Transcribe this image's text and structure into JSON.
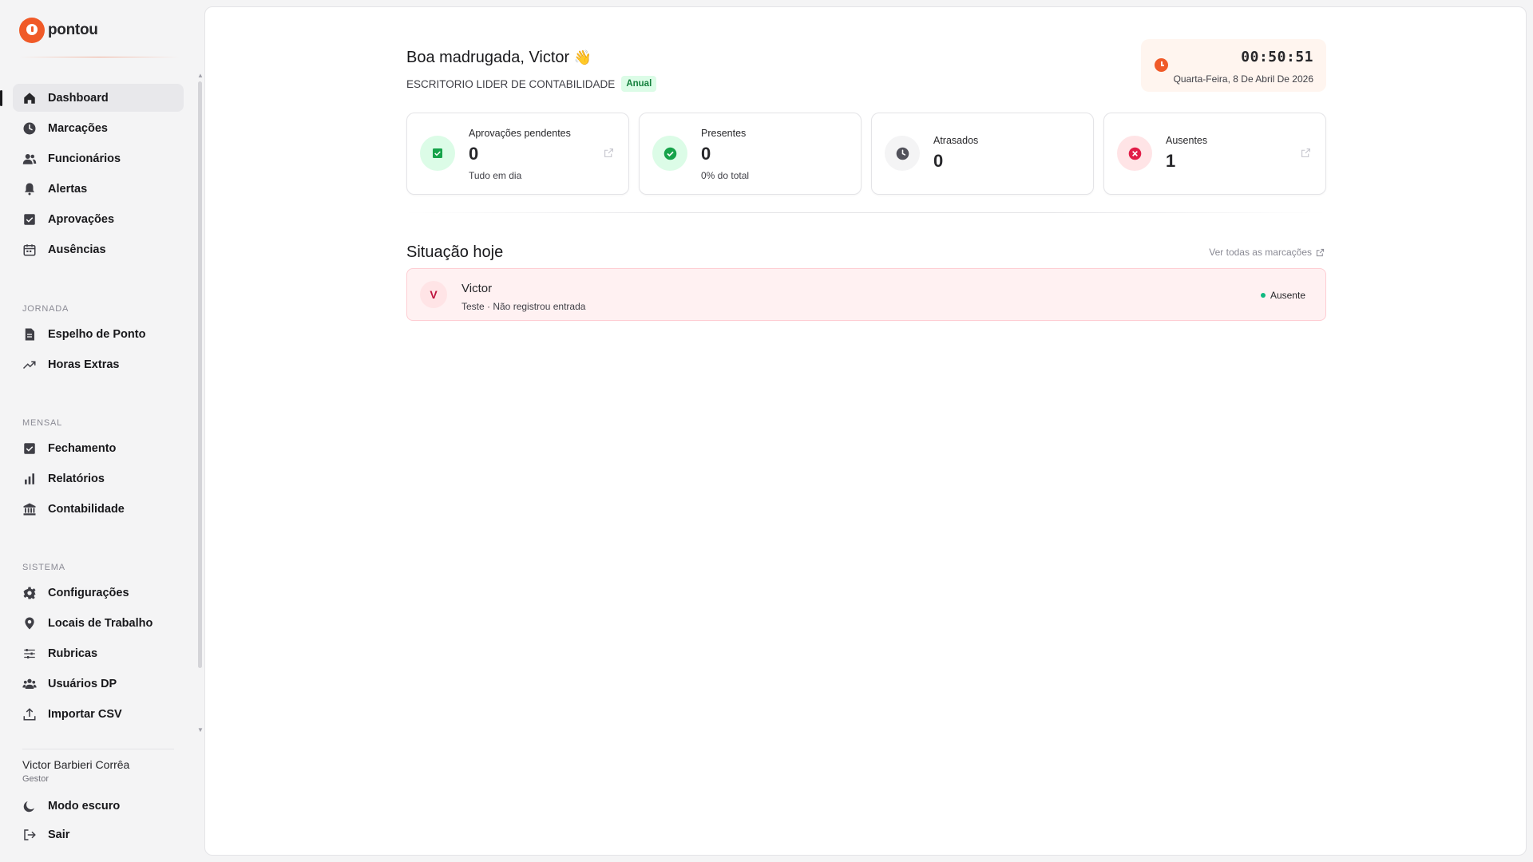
{
  "app": {
    "logo_text": "pontou",
    "brand_color": "#f05a28"
  },
  "sidebar": {
    "main_items": [
      {
        "label": "Dashboard",
        "icon": "home-icon",
        "active": true
      },
      {
        "label": "Marcações",
        "icon": "clock-icon"
      },
      {
        "label": "Funcionários",
        "icon": "users-icon"
      },
      {
        "label": "Alertas",
        "icon": "bell-icon"
      },
      {
        "label": "Aprovações",
        "icon": "check-square-icon"
      },
      {
        "label": "Ausências",
        "icon": "calendar-icon"
      }
    ],
    "sections": [
      {
        "title": "JORNADA",
        "items": [
          {
            "label": "Espelho de Ponto",
            "icon": "document-icon"
          },
          {
            "label": "Horas Extras",
            "icon": "trending-up-icon"
          }
        ]
      },
      {
        "title": "MENSAL",
        "items": [
          {
            "label": "Fechamento",
            "icon": "check-square-icon"
          },
          {
            "label": "Relatórios",
            "icon": "bar-chart-icon"
          },
          {
            "label": "Contabilidade",
            "icon": "bank-icon"
          }
        ]
      },
      {
        "title": "SISTEMA",
        "items": [
          {
            "label": "Configurações",
            "icon": "gear-icon"
          },
          {
            "label": "Locais de Trabalho",
            "icon": "map-pin-icon"
          },
          {
            "label": "Rubricas",
            "icon": "sliders-icon"
          },
          {
            "label": "Usuários DP",
            "icon": "users-icon"
          },
          {
            "label": "Importar CSV",
            "icon": "upload-icon"
          }
        ]
      }
    ],
    "user": {
      "name": "Victor Barbieri Corrêa",
      "role": "Gestor"
    },
    "footer": {
      "dark_mode_label": "Modo escuro",
      "logout_label": "Sair"
    }
  },
  "header": {
    "greeting": "Boa madrugada, Victor",
    "greeting_emoji": "👋",
    "company": "ESCRITORIO LIDER DE CONTABILIDADE",
    "plan": "Anual"
  },
  "clock": {
    "time": "00:50:51",
    "date": "Quarta-Feira, 8 De Abril De 2026"
  },
  "stats": [
    {
      "label": "Aprovações pendentes",
      "value": "0",
      "sub": "Tudo em dia",
      "icon": "check-square-icon",
      "icon_bg": "#dcfce7",
      "icon_color": "#16a34a",
      "external": true
    },
    {
      "label": "Presentes",
      "value": "0",
      "sub": "0% do total",
      "icon": "check-circle-icon",
      "icon_bg": "#dcfce7",
      "icon_color": "#16a34a",
      "external": false
    },
    {
      "label": "Atrasados",
      "value": "0",
      "sub": "",
      "icon": "clock-icon",
      "icon_bg": "#f4f4f5",
      "icon_color": "#52525b",
      "external": false
    },
    {
      "label": "Ausentes",
      "value": "1",
      "sub": "",
      "icon": "x-circle-icon",
      "icon_bg": "#ffe4e6",
      "icon_color": "#e11d48",
      "external": true
    }
  ],
  "today": {
    "title": "Situação hoje",
    "see_all": "Ver todas as marcações",
    "rows": [
      {
        "initial": "V",
        "name": "Victor",
        "detail": "Teste · Não registrou entrada",
        "status": "Ausente",
        "status_color": "#10b981"
      }
    ]
  }
}
